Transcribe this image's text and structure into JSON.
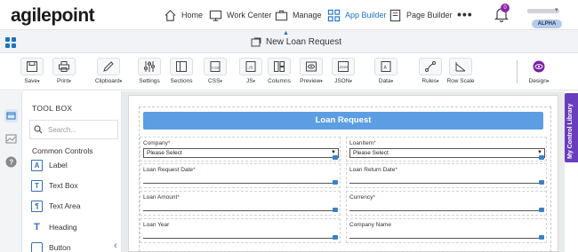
{
  "brand": {
    "logo_text": "agilepoint"
  },
  "nav": {
    "home": "Home",
    "work_center": "Work Center",
    "manage": "Manage",
    "app_builder": "App Builder",
    "page_builder": "Page Builder",
    "more": "•••",
    "notifications_count": "0",
    "env_badge": "ALPHA"
  },
  "titlebar": {
    "title": "New Loan Request"
  },
  "toolbar": {
    "save": "Save",
    "print": "Print",
    "clipboard": "Clipboard",
    "settings": "Settings",
    "sections": "Sections",
    "css": "CSS",
    "js": "JS",
    "columns": "Columns",
    "preview": "Preview",
    "json": "JSON",
    "data": "Data",
    "rules": "Rules",
    "row_scale": "Row Scale",
    "design": "Design"
  },
  "toolbox": {
    "title": "TOOL BOX",
    "search_placeholder": "Search...",
    "section": "Common Controls",
    "items": [
      {
        "label": "Label",
        "icon": "A"
      },
      {
        "label": "Text Box",
        "icon": "T"
      },
      {
        "label": "Text Area",
        "icon": "¶"
      },
      {
        "label": "Heading",
        "icon": "T"
      },
      {
        "label": "Button",
        "icon": ""
      }
    ]
  },
  "form": {
    "header": "Loan Request",
    "fields": [
      {
        "label": "Company",
        "required": "*",
        "value": "Please Select"
      },
      {
        "label": "LoanItem",
        "required": "*",
        "value": "Please Select"
      },
      {
        "label": "Loan Request Date",
        "required": "*"
      },
      {
        "label": "Loan Return Date",
        "required": "*"
      },
      {
        "label": "Loan Amount",
        "required": "*"
      },
      {
        "label": "Currency",
        "required": "*"
      },
      {
        "label": "Loan Year",
        "required": ""
      },
      {
        "label": "Company Name",
        "required": ""
      }
    ]
  },
  "control_library": {
    "label": "My Control Library"
  },
  "colors": {
    "accent": "#1e73be",
    "header": "#5d9ee2",
    "library": "#6a3dbd",
    "badge": "#8e24aa"
  }
}
